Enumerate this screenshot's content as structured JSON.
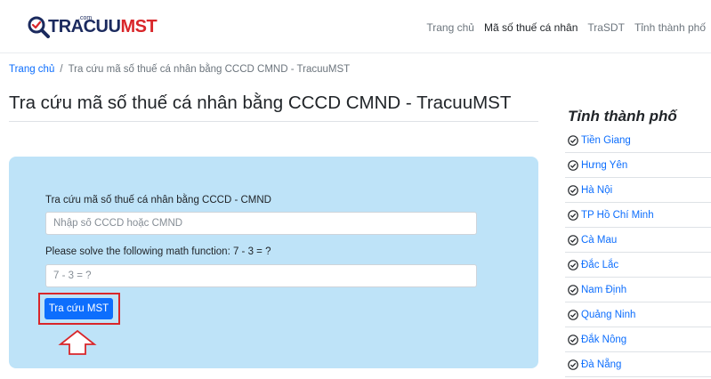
{
  "logo": {
    "part1": "TRACUU",
    "part2": "MST",
    "sub": ".com"
  },
  "nav": {
    "items": [
      {
        "label": "Trang chủ"
      },
      {
        "label": "Mã số thuế cá nhân"
      },
      {
        "label": "TraSDT"
      },
      {
        "label": "Tỉnh thành phố"
      }
    ],
    "active_index": 1
  },
  "breadcrumb": {
    "home": "Trang chủ",
    "separator": "/",
    "current": "Tra cứu mã số thuế cá nhân bằng CCCD CMND - TracuuMST"
  },
  "page": {
    "title": "Tra cứu mã số thuế cá nhân bằng CCCD CMND - TracuuMST"
  },
  "form": {
    "id_label": "Tra cứu mã số thuế cá nhân bằng CCCD - CMND",
    "id_placeholder": "Nhập số CCCD hoặc CMND",
    "captcha_label": "Please solve the following math function: 7 - 3 = ?",
    "captcha_placeholder": "7 - 3 = ?",
    "submit_label": "Tra cứu MST"
  },
  "sidebar": {
    "title": "Tỉnh thành phố",
    "provinces": [
      "Tiền Giang",
      "Hưng Yên",
      "Hà Nội",
      "TP Hồ Chí Minh",
      "Cà Mau",
      "Đắc Lắc",
      "Nam Định",
      "Quảng Ninh",
      "Đắk Nông",
      "Đà Nẵng"
    ]
  },
  "colors": {
    "accent": "#0d6efd",
    "panel": "#bee3f8",
    "highlight": "#d9262a",
    "brand_dark": "#1b2a5e"
  }
}
